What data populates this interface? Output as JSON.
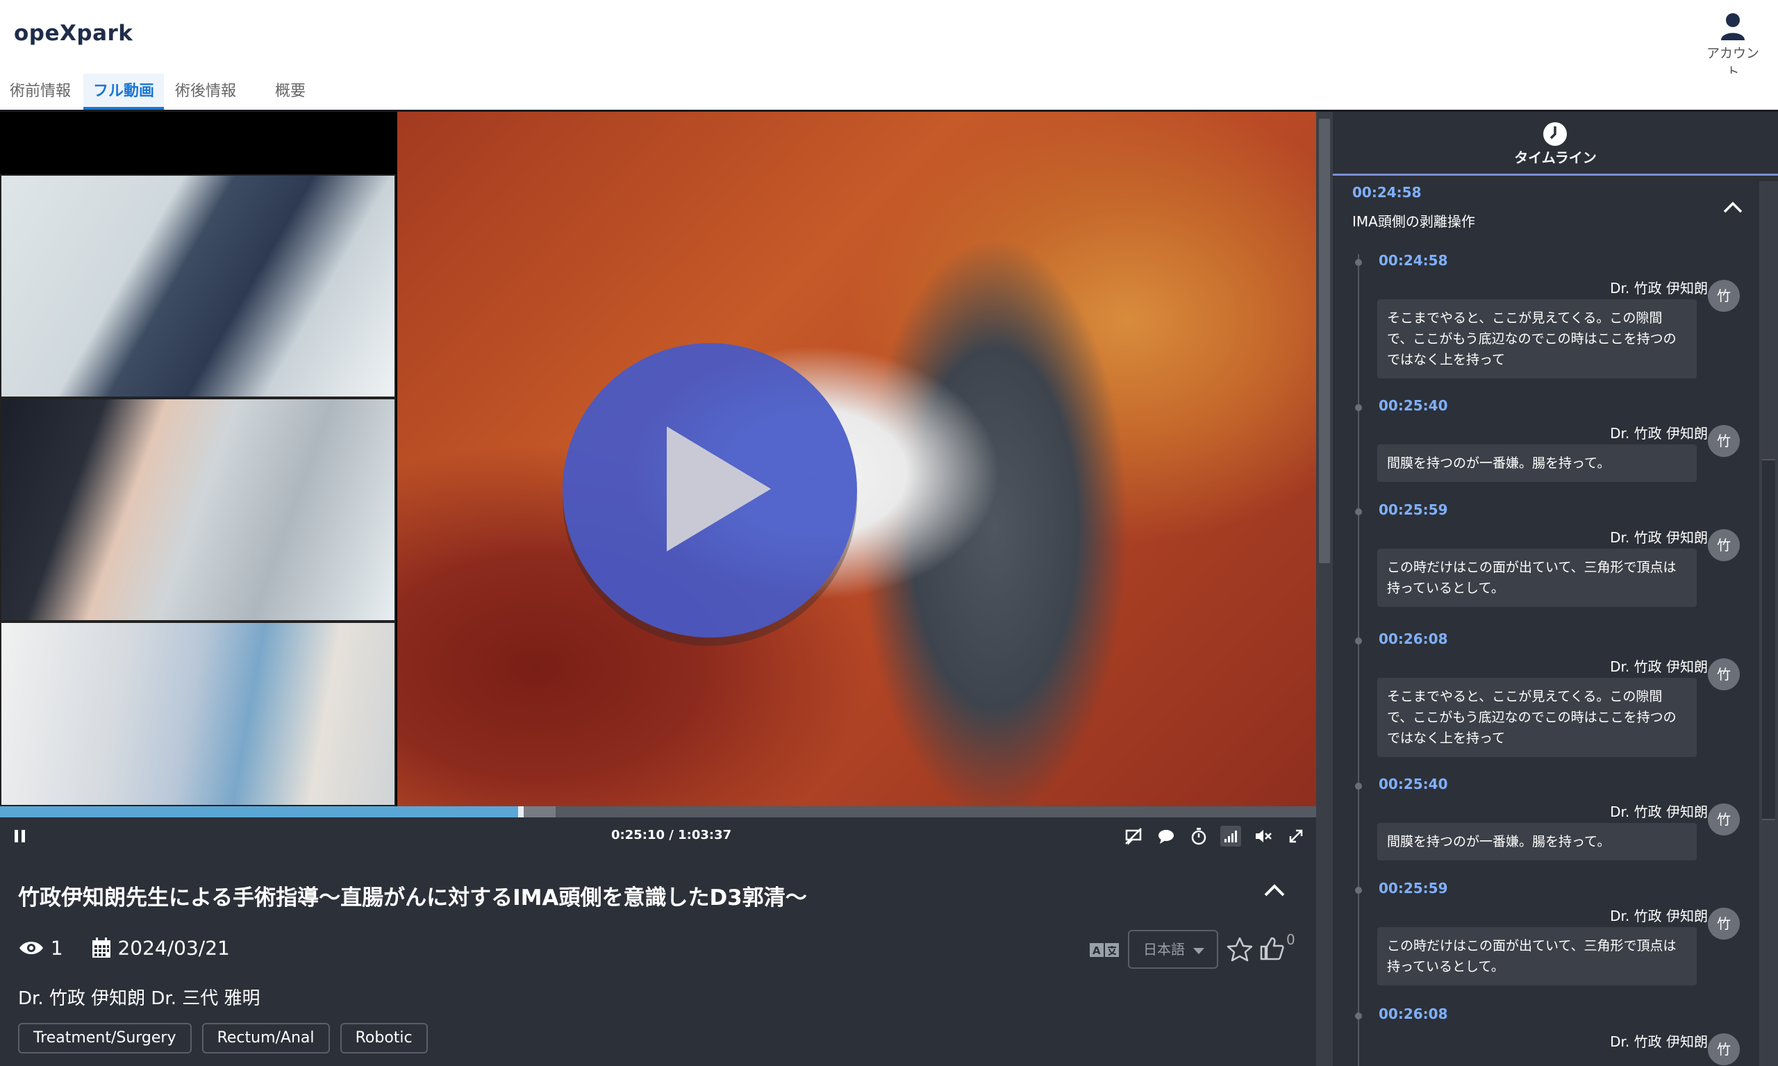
{
  "app": {
    "logo": "opeXpark",
    "account_label": "アカウント"
  },
  "tabs": [
    {
      "label": "術前情報"
    },
    {
      "label": "フル動画"
    },
    {
      "label": "術後情報"
    },
    {
      "label": "概要"
    }
  ],
  "player": {
    "time_display": "0:25:10 / 1:03:37",
    "progress_fraction": 0.396
  },
  "video_info": {
    "title": "竹政伊知朗先生による手術指導〜直腸がんに対するIMA頭側を意識したD3郭清〜",
    "views": "1",
    "date": "2024/03/21",
    "doctors": "Dr. 竹政 伊知朗  Dr. 三代 雅明",
    "tags": [
      "Treatment/Surgery",
      "Rectum/Anal",
      "Robotic"
    ],
    "language": "日本語",
    "like_count": "0"
  },
  "timeline": {
    "header_label": "タイムライン",
    "group_time": "00:24:58",
    "group_title": "IMA頭側の剥離操作",
    "entries": [
      {
        "time": "00:24:58",
        "author": "Dr. 竹政 伊知朗",
        "avatar": "竹",
        "text": "そこまでやると、ここが見えてくる。この隙間で、ここがもう底辺なのでこの時はここを持つのではなく上を持って"
      },
      {
        "time": "00:25:40",
        "author": "Dr. 竹政 伊知朗",
        "avatar": "竹",
        "text": "間膜を持つのが一番嫌。腸を持って。"
      },
      {
        "time": "00:25:59",
        "author": "Dr. 竹政 伊知朗",
        "avatar": "竹",
        "text": "この時だけはこの面が出ていて、三角形で頂点は持っているとして。"
      },
      {
        "time": "00:26:08",
        "author": "Dr. 竹政 伊知朗",
        "avatar": "竹",
        "text": "そこまでやると、ここが見えてくる。この隙間で、ここがもう底辺なのでこの時はここを持つのではなく上を持って"
      },
      {
        "time": "00:25:40",
        "author": "Dr. 竹政 伊知朗",
        "avatar": "竹",
        "text": "間膜を持つのが一番嫌。腸を持って。"
      },
      {
        "time": "00:25:59",
        "author": "Dr. 竹政 伊知朗",
        "avatar": "竹",
        "text": "この時だけはこの面が出ていて、三角形で頂点は持っているとして。"
      },
      {
        "time": "00:26:08",
        "author": "Dr. 竹政 伊知朗",
        "avatar": "竹",
        "text": ""
      }
    ]
  },
  "colors": {
    "accent": "#1976d2",
    "timestamp": "#7fb0ff",
    "progress": "#5aa7d6",
    "play_button": "#465ac8"
  }
}
